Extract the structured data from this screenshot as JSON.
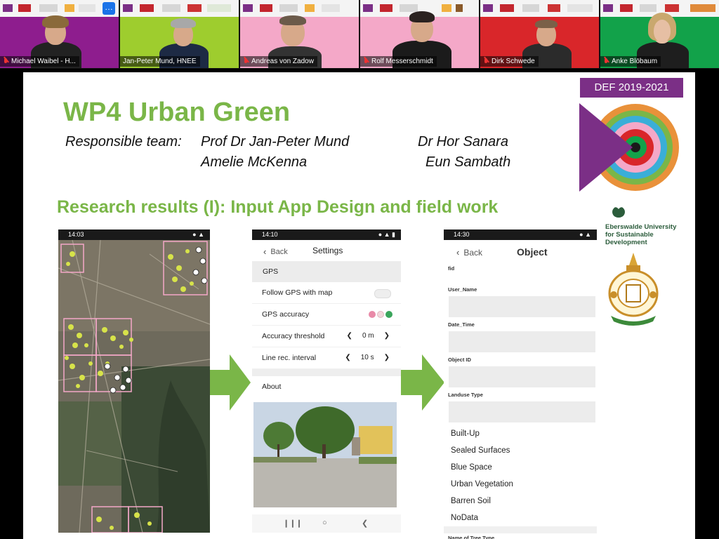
{
  "participants": [
    {
      "name": "Michael Waibel - H...",
      "bg": "#8e1d8e"
    },
    {
      "name": "Jan-Peter Mund, HNEE",
      "bg": "#9ecd2e"
    },
    {
      "name": "Andreas von Zadow",
      "bg": "#f4a8c8"
    },
    {
      "name": "Rolf Messerschmidt",
      "bg": "#f4a8c8"
    },
    {
      "name": "Dirk Schwede",
      "bg": "#d9262a"
    },
    {
      "name": "Anke Blöbaum",
      "bg": "#12a24a"
    }
  ],
  "more_button": "…",
  "slide": {
    "badge": "DEF 2019-2021",
    "title": "WP4 Urban Green",
    "team_label": "Responsible team:",
    "team_names": [
      "Prof Dr Jan-Peter Mund",
      "Dr Hor Sanara",
      "Amelie McKenna",
      "Eun Sambath"
    ],
    "subtitle": "Research results (I): Input App Design and field work",
    "university": "Eberswalde University for Sustainable Development",
    "colors": {
      "green": "#7ab648",
      "purple": "#7b2f86"
    }
  },
  "phone_map": {
    "time": "14:03"
  },
  "phone_settings": {
    "time": "14:10",
    "back": "Back",
    "title": "Settings",
    "section_gps": "GPS",
    "follow_gps": "Follow GPS with map",
    "gps_accuracy": "GPS accuracy",
    "accuracy_threshold": "Accuracy threshold",
    "threshold_value": "0 m",
    "line_rec_interval": "Line rec. interval",
    "interval_value": "10 s",
    "section_about": "About"
  },
  "phone_object": {
    "time": "14:30",
    "back": "Back",
    "title": "Object",
    "fields": [
      "fid",
      "User_Name",
      "Date_Time",
      "Object ID",
      "Landuse Type"
    ],
    "landuse_options": [
      "Built-Up",
      "Sealed Surfaces",
      "Blue Space",
      "Urban Vegetation",
      "Barren Soil",
      "NoData"
    ],
    "next_field": "Name of Tree Type"
  }
}
